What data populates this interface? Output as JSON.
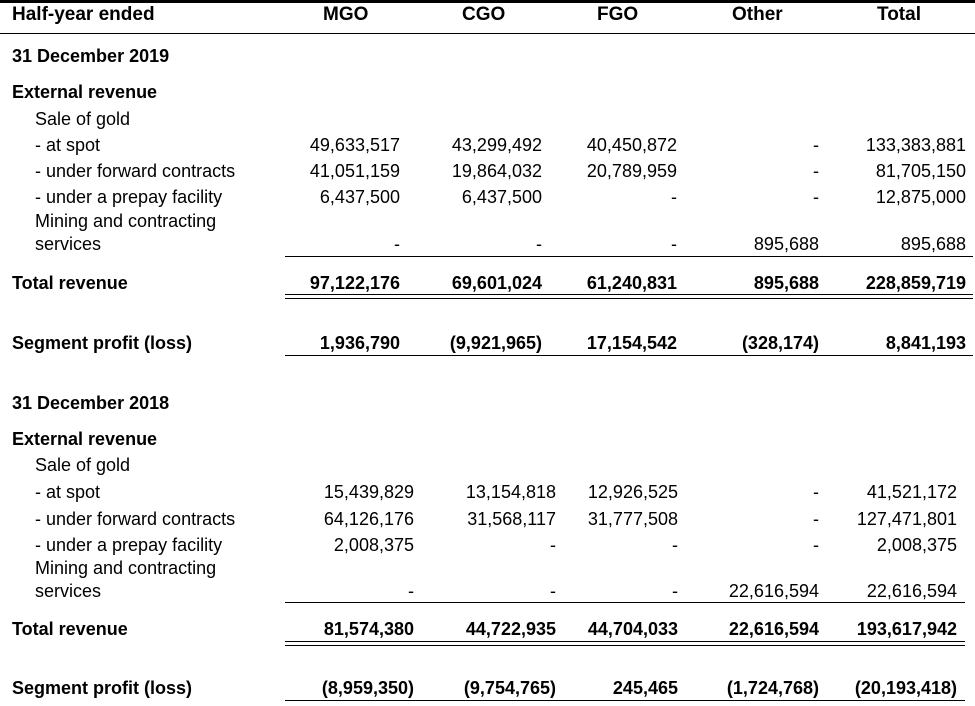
{
  "header": {
    "label": "Half-year ended",
    "columns": [
      "MGO",
      "CGO",
      "FGO",
      "Other",
      "Total"
    ]
  },
  "sections": [
    {
      "period": "31 December 2019",
      "external_revenue_label": "External revenue",
      "sale_of_gold_label": "Sale of gold",
      "rows": [
        {
          "label": "- at spot",
          "values": [
            "49,633,517",
            "43,299,492",
            "40,450,872",
            "-",
            "133,383,881"
          ]
        },
        {
          "label": "- under forward contracts",
          "values": [
            "41,051,159",
            "19,864,032",
            "20,789,959",
            "-",
            "81,705,150"
          ]
        },
        {
          "label": "- under a prepay facility",
          "values": [
            "6,437,500",
            "6,437,500",
            "-",
            "-",
            "12,875,000"
          ]
        },
        {
          "label_line1": "Mining and contracting",
          "label_line2": "services",
          "values": [
            "-",
            "-",
            "-",
            "895,688",
            "895,688"
          ]
        }
      ],
      "total_revenue": {
        "label": "Total revenue",
        "values": [
          "97,122,176",
          "69,601,024",
          "61,240,831",
          "895,688",
          "228,859,719"
        ]
      },
      "segment_profit": {
        "label": "Segment profit (loss)",
        "values": [
          "1,936,790",
          "(9,921,965)",
          "17,154,542",
          "(328,174)",
          "8,841,193"
        ]
      }
    },
    {
      "period": "31 December 2018",
      "external_revenue_label": "External revenue",
      "sale_of_gold_label": "Sale of gold",
      "rows": [
        {
          "label": "- at spot",
          "values": [
            "15,439,829",
            "13,154,818",
            "12,926,525",
            "-",
            "41,521,172"
          ]
        },
        {
          "label": "- under forward contracts",
          "values": [
            "64,126,176",
            "31,568,117",
            "31,777,508",
            "-",
            "127,471,801"
          ]
        },
        {
          "label": "- under a prepay facility",
          "values": [
            "2,008,375",
            "-",
            "-",
            "-",
            "2,008,375"
          ]
        },
        {
          "label_line1": "Mining and contracting",
          "label_line2": "services",
          "values": [
            "-",
            "-",
            "-",
            "22,616,594",
            "22,616,594"
          ]
        }
      ],
      "total_revenue": {
        "label": "Total revenue",
        "values": [
          "81,574,380",
          "44,722,935",
          "44,704,033",
          "22,616,594",
          "193,617,942"
        ]
      },
      "segment_profit": {
        "label": "Segment profit (loss)",
        "values": [
          "(8,959,350)",
          "(9,754,765)",
          "245,465",
          "(1,724,768)",
          "(20,193,418)"
        ]
      }
    }
  ]
}
